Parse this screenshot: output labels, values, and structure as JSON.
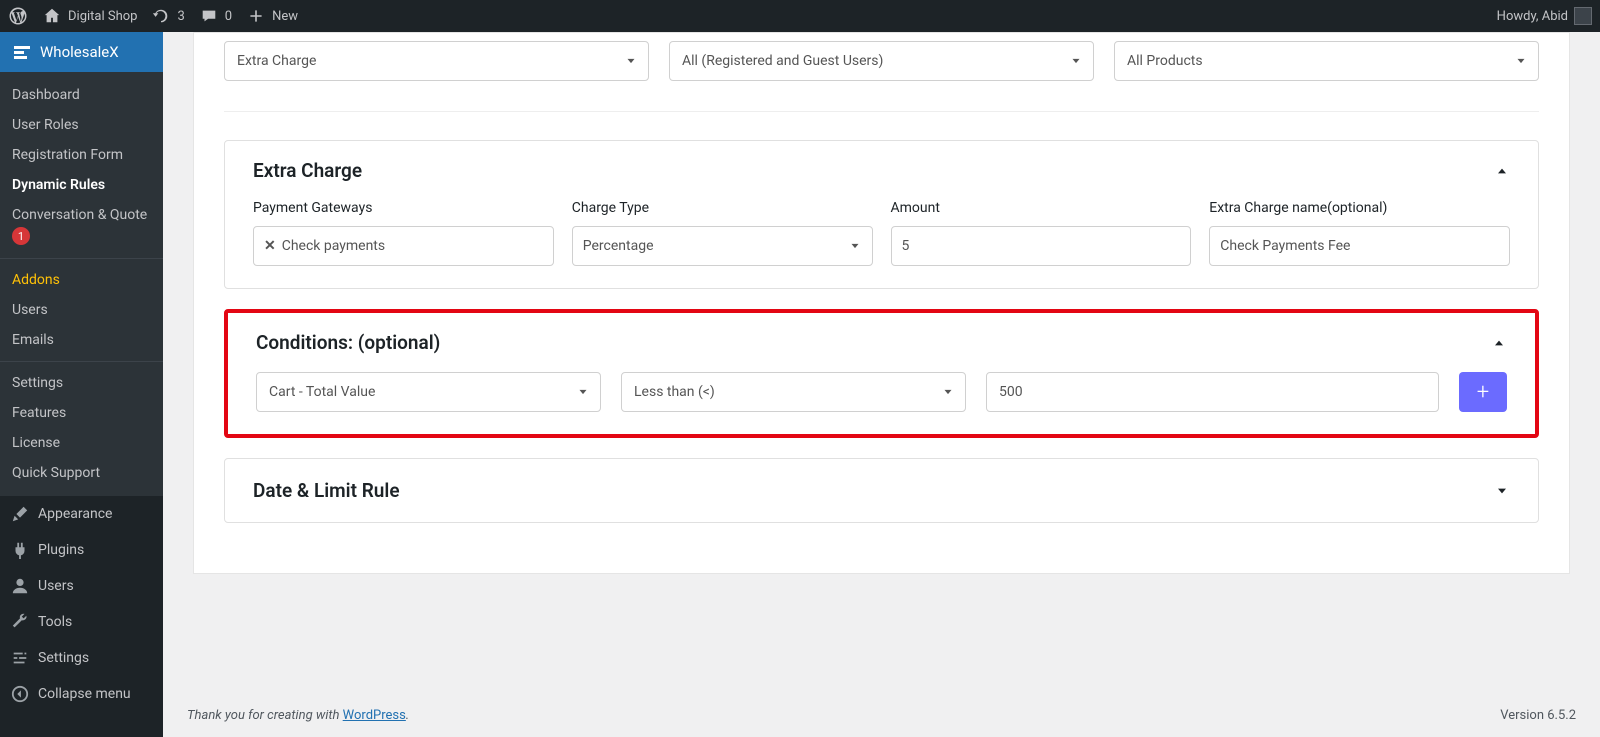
{
  "adminbar": {
    "site_name": "Digital Shop",
    "updates": "3",
    "comments": "0",
    "new": "New",
    "howdy": "Howdy, Abid"
  },
  "sidebar": {
    "plugin_name": "WholesaleX",
    "sub": {
      "dashboard": "Dashboard",
      "user_roles": "User Roles",
      "registration_form": "Registration Form",
      "dynamic_rules": "Dynamic Rules",
      "conversation_quote": "Conversation & Quote",
      "badge_count": "1",
      "addons": "Addons",
      "users": "Users",
      "emails": "Emails",
      "settings": "Settings",
      "features": "Features",
      "license": "License",
      "quick_support": "Quick Support"
    },
    "main": {
      "appearance": "Appearance",
      "plugins": "Plugins",
      "users": "Users",
      "tools": "Tools",
      "settings": "Settings",
      "collapse": "Collapse menu"
    }
  },
  "top_selects": {
    "rule_type": "Extra Charge",
    "user_filter": "All (Registered and Guest Users)",
    "product_filter": "All Products"
  },
  "extra_charge": {
    "title": "Extra Charge",
    "labels": {
      "gateways": "Payment Gateways",
      "charge_type": "Charge Type",
      "amount": "Amount",
      "name": "Extra Charge name(optional)"
    },
    "gateway_chip": "Check payments",
    "charge_type_value": "Percentage",
    "amount_value": "5",
    "name_value": "Check Payments Fee"
  },
  "conditions": {
    "title": "Conditions: (optional)",
    "type": "Cart - Total Value",
    "operator": "Less than (<)",
    "value": "500"
  },
  "date_limit": {
    "title": "Date & Limit Rule"
  },
  "footer": {
    "thanks_prefix": "Thank you for creating with ",
    "wp": "WordPress",
    "period": ".",
    "version": "Version 6.5.2"
  }
}
